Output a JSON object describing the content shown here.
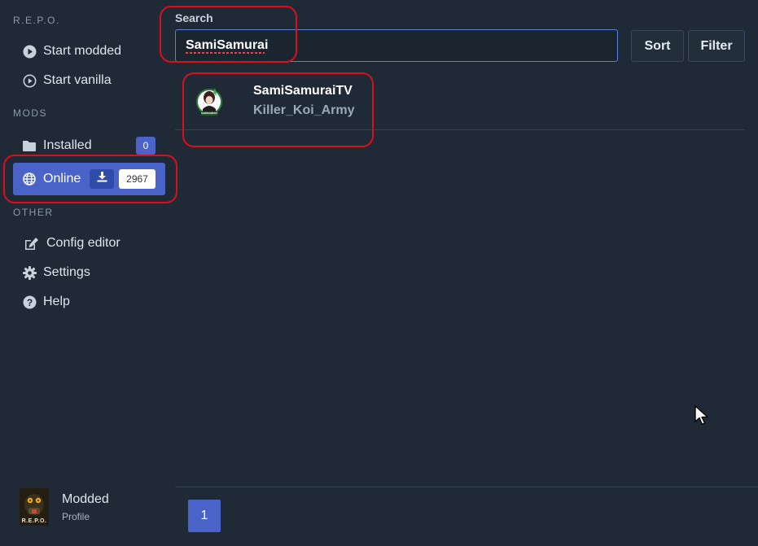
{
  "sidebar": {
    "app_label": "R.E.P.O.",
    "start_modded": "Start modded",
    "start_vanilla": "Start vanilla",
    "mods_label": "MODS",
    "installed": "Installed",
    "installed_count": "0",
    "online": "Online",
    "online_count": "2967",
    "other_label": "OTHER",
    "config_editor": "Config editor",
    "settings": "Settings",
    "help": "Help"
  },
  "profile": {
    "name": "Modded",
    "sub": "Profile",
    "avatar_text": "R.E.P.O."
  },
  "search": {
    "label": "Search",
    "value": "SamiSamurai"
  },
  "toolbar": {
    "sort": "Sort",
    "filter": "Filter"
  },
  "results": [
    {
      "title": "SamiSamuraiTV",
      "author": "Killer_Koi_Army",
      "thumb_text": "SAMISAMURAITV"
    }
  ],
  "pagination": {
    "current_page": "1"
  },
  "colors": {
    "background": "#1f2a36",
    "accent": "#4a63c8",
    "annotation": "#d8101c"
  }
}
